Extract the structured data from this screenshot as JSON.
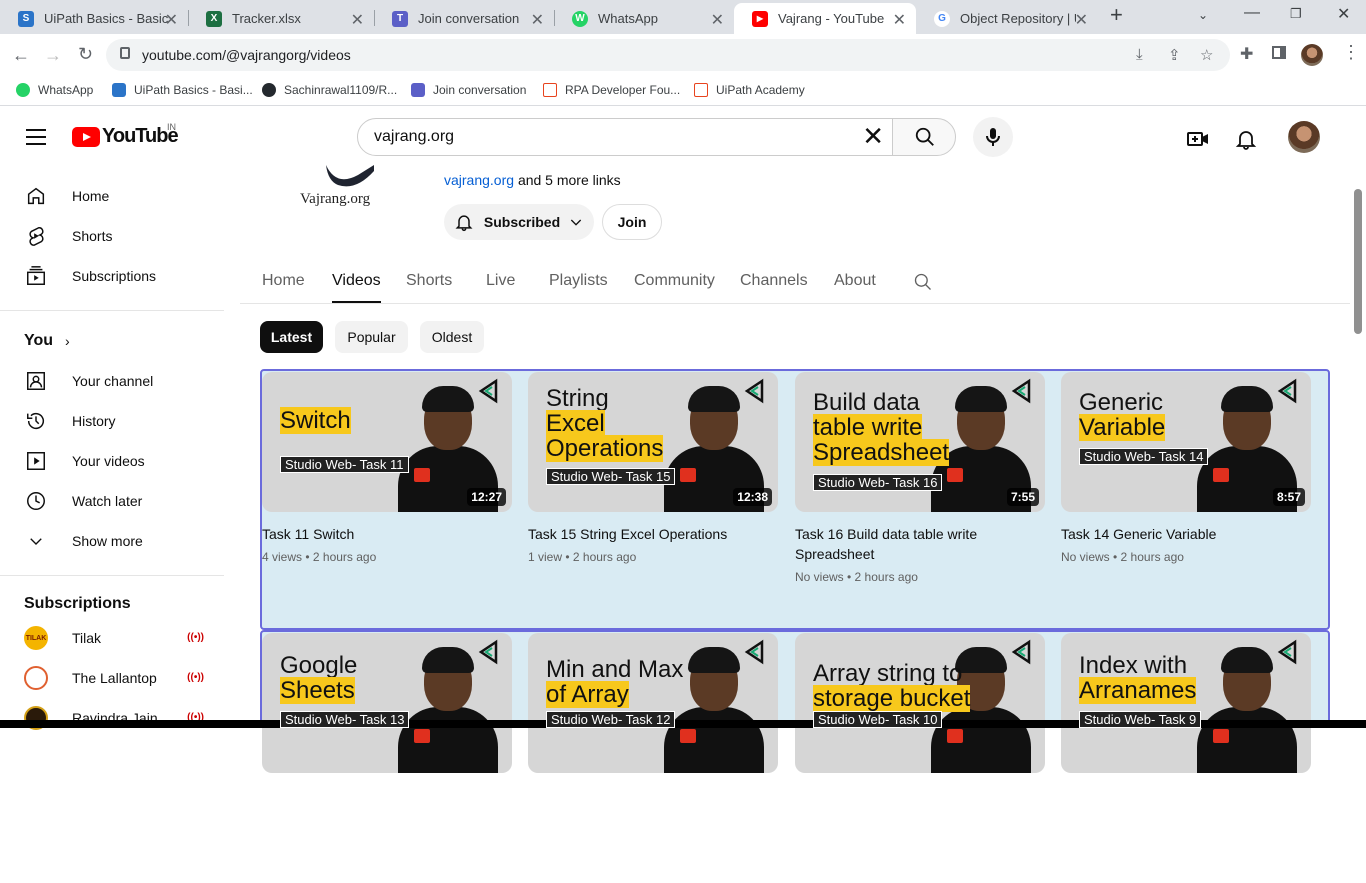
{
  "browser": {
    "tabs": [
      {
        "title": "UiPath Basics - Basics",
        "color": "#2b74c8",
        "glyph": "S"
      },
      {
        "title": "Tracker.xlsx",
        "color": "#1d6f42",
        "glyph": "X"
      },
      {
        "title": "Join conversation",
        "color": "#5b5fc7",
        "glyph": "T"
      },
      {
        "title": "WhatsApp",
        "color": "#25d366",
        "glyph": "W"
      },
      {
        "title": "Vajrang - YouTube",
        "color": "#ff0000",
        "glyph": "▶"
      },
      {
        "title": "Object Repository | U",
        "color": "#ffffff",
        "glyph": "G"
      }
    ],
    "url": "youtube.com/@vajrangorg/videos",
    "bookmarks": [
      {
        "label": "WhatsApp",
        "color": "#25d366"
      },
      {
        "label": "UiPath Basics - Basi...",
        "color": "#2b74c8"
      },
      {
        "label": "Sachinrawal1109/R...",
        "color": "#24292e"
      },
      {
        "label": "Join conversation",
        "color": "#5b5fc7"
      },
      {
        "label": "RPA Developer Fou...",
        "color": "#e8441e"
      },
      {
        "label": "UiPath Academy",
        "color": "#e8441e"
      }
    ]
  },
  "header": {
    "logo_text": "YouTube",
    "country": "IN",
    "search_value": "vajrang.org"
  },
  "sidebar": {
    "main": [
      {
        "label": "Home",
        "icon": "home-icon"
      },
      {
        "label": "Shorts",
        "icon": "shorts-icon"
      },
      {
        "label": "Subscriptions",
        "icon": "subscriptions-icon"
      }
    ],
    "you_label": "You",
    "you": [
      {
        "label": "Your channel",
        "icon": "channel-icon"
      },
      {
        "label": "History",
        "icon": "history-icon"
      },
      {
        "label": "Your videos",
        "icon": "videos-icon"
      },
      {
        "label": "Watch later",
        "icon": "clock-icon"
      },
      {
        "label": "Show more",
        "icon": "chevron-down-icon"
      }
    ],
    "subs_label": "Subscriptions",
    "subs": [
      {
        "label": "Tilak",
        "badge": "TILAK"
      },
      {
        "label": "The Lallantop",
        "badge": ""
      },
      {
        "label": "Ravindra Jain",
        "badge": ""
      }
    ]
  },
  "channel": {
    "name": "Vajrang.org",
    "link": "vajrang.org",
    "more_links": "and 5 more links",
    "subscribed_label": "Subscribed",
    "join_label": "Join",
    "tabs": [
      "Home",
      "Videos",
      "Shorts",
      "Live",
      "Playlists",
      "Community",
      "Channels",
      "About"
    ],
    "active_tab": "Videos",
    "chips": [
      "Latest",
      "Popular",
      "Oldest"
    ]
  },
  "videos": [
    {
      "title": "Task 11 Switch",
      "meta": "4 views • 2 hours ago",
      "duration": "12:27",
      "thumb_lines": [
        "Switch"
      ],
      "thumb_sub": "Studio Web- Task 11"
    },
    {
      "title": "Task 15 String Excel Operations",
      "meta": "1 view • 2 hours ago",
      "duration": "12:38",
      "thumb_lines": [
        "String",
        "Excel",
        "Operations"
      ],
      "thumb_sub": "Studio Web- Task 15"
    },
    {
      "title": "Task 16 Build data table write Spreadsheet",
      "meta": "No views • 2 hours ago",
      "duration": "7:55",
      "thumb_lines": [
        "Build data",
        "table write",
        "Spreadsheet"
      ],
      "thumb_sub": "Studio Web- Task 16"
    },
    {
      "title": "Task 14 Generic Variable",
      "meta": "No views • 2 hours ago",
      "duration": "8:57",
      "thumb_lines": [
        "Generic",
        "Variable"
      ],
      "thumb_sub": "Studio Web- Task 14"
    },
    {
      "title": "",
      "meta": "",
      "duration": "",
      "thumb_lines": [
        "Google",
        "Sheets"
      ],
      "thumb_sub": "Studio Web- Task 13"
    },
    {
      "title": "",
      "meta": "",
      "duration": "",
      "thumb_lines": [
        "Min and Max",
        "of Array"
      ],
      "thumb_sub": "Studio Web- Task 12"
    },
    {
      "title": "",
      "meta": "",
      "duration": "",
      "thumb_lines": [
        "Array string to",
        "storage bucket"
      ],
      "thumb_sub": "Studio Web- Task 10"
    },
    {
      "title": "",
      "meta": "",
      "duration": "",
      "thumb_lines": [
        "Index with",
        "Arranames"
      ],
      "thumb_sub": "Studio Web- Task 9"
    }
  ]
}
